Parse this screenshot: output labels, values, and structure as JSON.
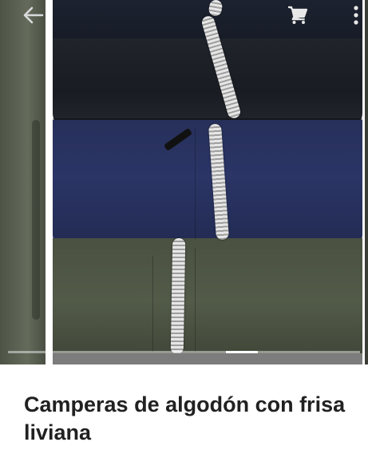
{
  "toolbar": {
    "back_icon": "arrow-left-icon",
    "cart_icon": "shopping-cart-icon",
    "more_icon": "more-vert-icon"
  },
  "carousel": {
    "current_index": 2,
    "progress_start_fraction": 0.62,
    "progress_end_fraction": 0.71,
    "image_description": "stacked zip-up cotton jackets in black, navy and olive",
    "colors": {
      "black": "#1b1f27",
      "navy": "#2b3566",
      "olive": "#525a48"
    }
  },
  "product": {
    "title": "Camperas de algodón con frisa liviana"
  }
}
